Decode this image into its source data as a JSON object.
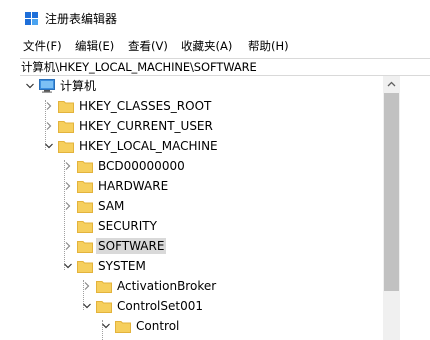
{
  "window": {
    "title": "注册表编辑器",
    "app_icon": "registry-editor-icon",
    "icon_colors": [
      "#1e6fd9",
      "#1e6fd9",
      "#1e6fd9",
      "#4aa3f0"
    ]
  },
  "menu": {
    "items": [
      {
        "label": "文件(F)"
      },
      {
        "label": "编辑(E)"
      },
      {
        "label": "查看(V)"
      },
      {
        "label": "收藏夹(A)"
      },
      {
        "label": "帮助(H)"
      }
    ]
  },
  "address": {
    "path": "计算机\\HKEY_LOCAL_MACHINE\\SOFTWARE"
  },
  "tree": {
    "root": {
      "label": "计算机",
      "expanded": true,
      "icon": "computer-icon"
    },
    "nodes": [
      {
        "label": "HKEY_CLASSES_ROOT",
        "expanded": false,
        "has_children": true
      },
      {
        "label": "HKEY_CURRENT_USER",
        "expanded": false,
        "has_children": true
      },
      {
        "label": "HKEY_LOCAL_MACHINE",
        "expanded": true,
        "has_children": true
      },
      {
        "label": "BCD00000000",
        "expanded": false,
        "has_children": true
      },
      {
        "label": "HARDWARE",
        "expanded": false,
        "has_children": true
      },
      {
        "label": "SAM",
        "expanded": false,
        "has_children": true
      },
      {
        "label": "SECURITY",
        "expanded": false,
        "has_children": false
      },
      {
        "label": "SOFTWARE",
        "expanded": false,
        "has_children": true,
        "selected": true
      },
      {
        "label": "SYSTEM",
        "expanded": true,
        "has_children": true
      },
      {
        "label": "ActivationBroker",
        "expanded": false,
        "has_children": true
      },
      {
        "label": "ControlSet001",
        "expanded": true,
        "has_children": true
      },
      {
        "label": "Control",
        "expanded": true,
        "has_children": true
      }
    ]
  },
  "colors": {
    "folder": "#f6cf5d",
    "folder_dark": "#e3b33c",
    "selection": "#d9d9d9",
    "computer_screen": "#3c8fe0"
  }
}
